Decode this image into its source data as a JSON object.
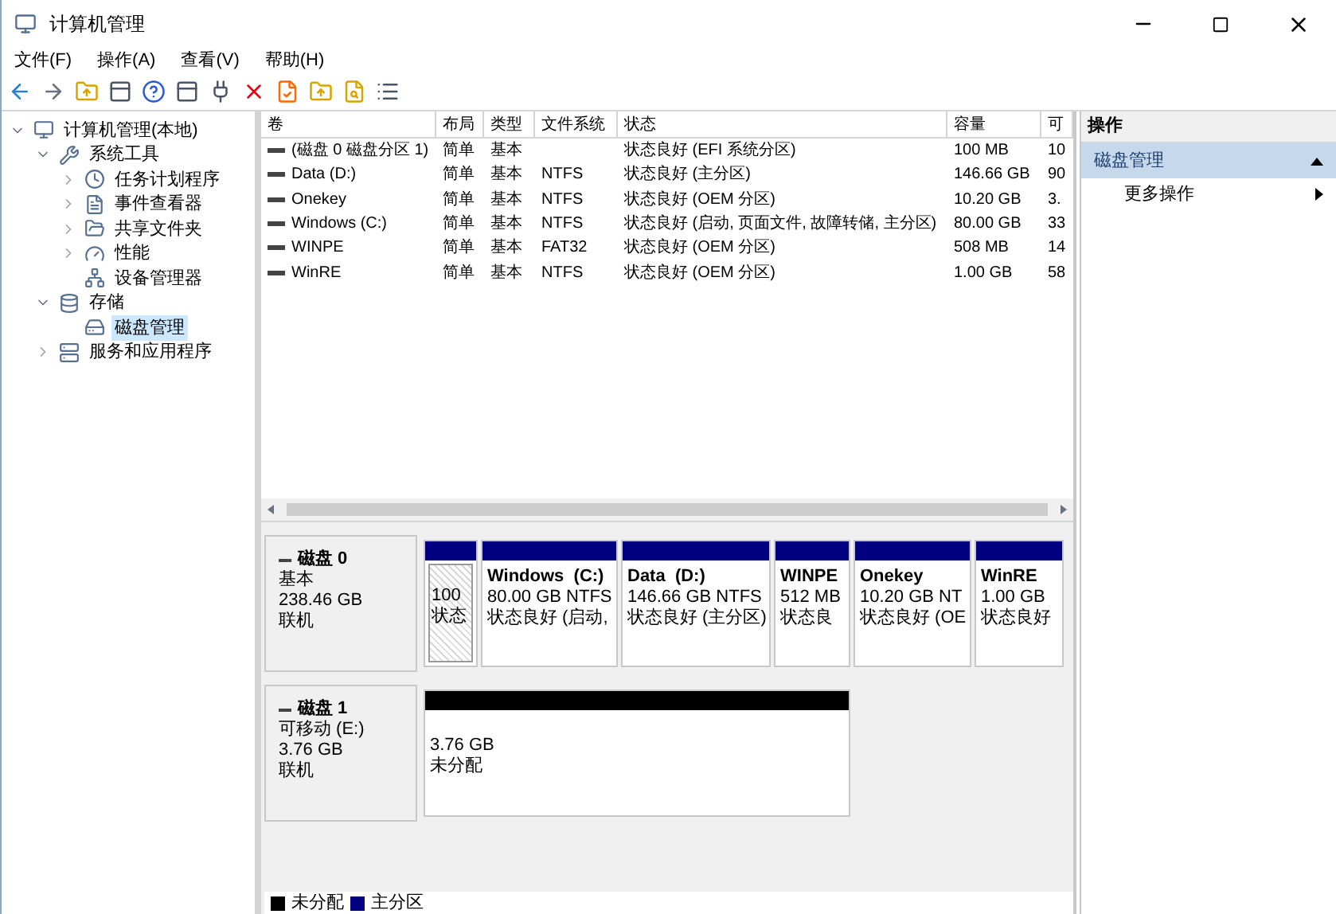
{
  "window": {
    "title": "计算机管理"
  },
  "menu": [
    "文件(F)",
    "操作(A)",
    "查看(V)",
    "帮助(H)"
  ],
  "tree": [
    {
      "label": "计算机管理(本地)",
      "expanded": true,
      "selected": false,
      "children": [
        {
          "label": "系统工具",
          "expanded": true,
          "selected": false,
          "children": [
            {
              "label": "任务计划程序",
              "expanded": false,
              "selected": false
            },
            {
              "label": "事件查看器",
              "expanded": false,
              "selected": false
            },
            {
              "label": "共享文件夹",
              "expanded": false,
              "selected": false
            },
            {
              "label": "性能",
              "expanded": false,
              "selected": false
            },
            {
              "label": "设备管理器",
              "selected": false
            }
          ]
        },
        {
          "label": "存储",
          "expanded": true,
          "selected": false,
          "children": [
            {
              "label": "磁盘管理",
              "selected": true
            }
          ]
        },
        {
          "label": "服务和应用程序",
          "expanded": false,
          "selected": false
        }
      ]
    }
  ],
  "table": {
    "columns": [
      "卷",
      "布局",
      "类型",
      "文件系统",
      "状态",
      "容量",
      "可"
    ],
    "rows": [
      [
        "(磁盘 0 磁盘分区 1)",
        "简单",
        "基本",
        "",
        "状态良好 (EFI 系统分区)",
        "100 MB",
        "10"
      ],
      [
        "Data (D:)",
        "简单",
        "基本",
        "NTFS",
        "状态良好 (主分区)",
        "146.66 GB",
        "90"
      ],
      [
        "Onekey",
        "简单",
        "基本",
        "NTFS",
        "状态良好 (OEM 分区)",
        "10.20 GB",
        "3."
      ],
      [
        "Windows (C:)",
        "简单",
        "基本",
        "NTFS",
        "状态良好 (启动, 页面文件, 故障转储, 主分区)",
        "80.00 GB",
        "33"
      ],
      [
        "WINPE",
        "简单",
        "基本",
        "FAT32",
        "状态良好 (OEM 分区)",
        "508 MB",
        "14"
      ],
      [
        "WinRE",
        "简单",
        "基本",
        "NTFS",
        "状态良好 (OEM 分区)",
        "1.00 GB",
        "58"
      ]
    ]
  },
  "disks": [
    {
      "name": "磁盘 0",
      "type": "基本",
      "size": "238.46 GB",
      "status": "联机",
      "partitions": [
        {
          "color": "#000080",
          "hatched": true,
          "lines": [
            "100",
            "状态"
          ]
        },
        {
          "color": "#000080",
          "hatched": false,
          "name": "Windows  (C:)",
          "lines": [
            "80.00 GB NTFS",
            "状态良好 (启动,"
          ]
        },
        {
          "color": "#000080",
          "hatched": false,
          "name": "Data  (D:)",
          "lines": [
            "146.66 GB NTFS",
            "状态良好 (主分区)"
          ]
        },
        {
          "color": "#000080",
          "hatched": false,
          "name": "WINPE",
          "lines": [
            "512 MB",
            "状态良"
          ]
        },
        {
          "color": "#000080",
          "hatched": false,
          "name": "Onekey",
          "lines": [
            "10.20 GB NT",
            "状态良好 (OE"
          ]
        },
        {
          "color": "#000080",
          "hatched": false,
          "name": "WinRE",
          "lines": [
            "1.00 GB",
            "状态良好"
          ]
        }
      ]
    },
    {
      "name": "磁盘 1",
      "type": "可移动 (E:)",
      "size": "3.76 GB",
      "status": "联机",
      "partitions": [
        {
          "color": "#000000",
          "hatched": false,
          "lines": [
            "3.76 GB",
            "未分配"
          ]
        }
      ]
    }
  ],
  "legend": [
    {
      "label": "未分配",
      "color": "#000000"
    },
    {
      "label": "主分区",
      "color": "#000080"
    }
  ],
  "actions": {
    "title": "操作",
    "section": "磁盘管理",
    "items": [
      "更多操作"
    ]
  }
}
